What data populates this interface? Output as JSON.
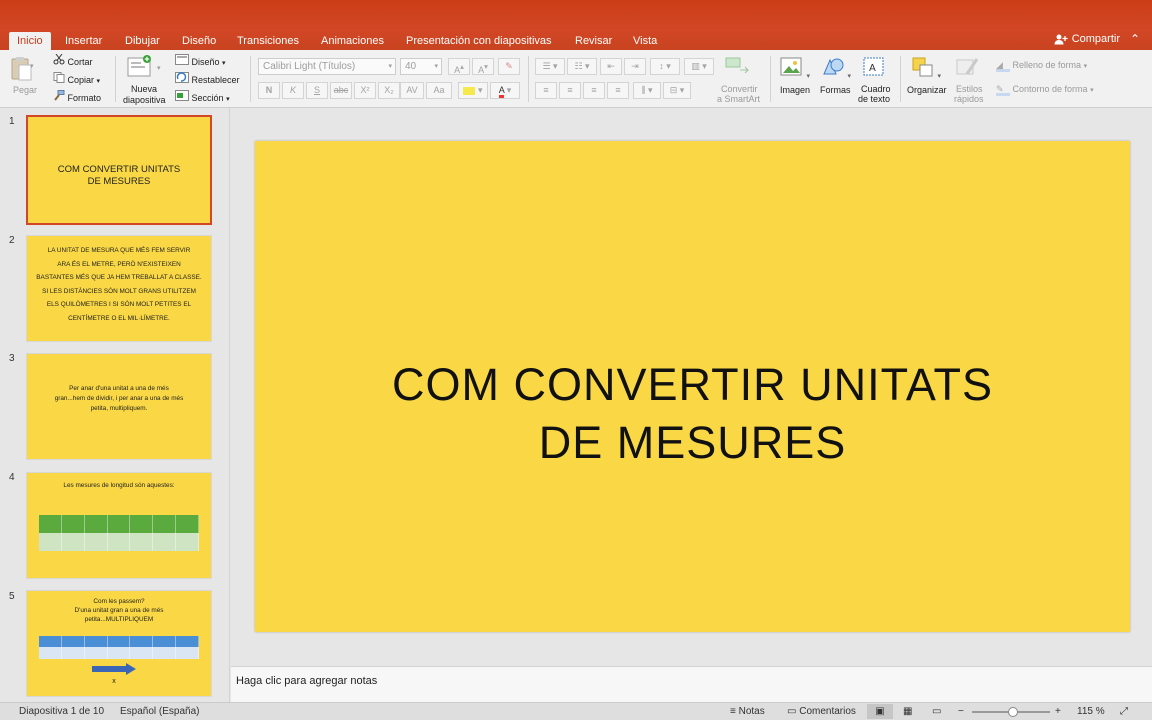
{
  "tabs": [
    "Inicio",
    "Insertar",
    "Dibujar",
    "Diseño",
    "Transiciones",
    "Animaciones",
    "Presentación con diapositivas",
    "Revisar",
    "Vista"
  ],
  "share_label": "Compartir",
  "ribbon": {
    "paste": "Pegar",
    "cut": "Cortar",
    "copy": "Copiar",
    "format": "Formato",
    "new_slide_1": "Nueva",
    "new_slide_2": "diapositiva",
    "layout": "Diseño",
    "reset": "Restablecer",
    "section": "Sección",
    "font_name": "Calibri Light (Títulos)",
    "font_size": "40",
    "convert_1": "Convertir",
    "convert_2": "a SmartArt",
    "image": "Imagen",
    "shapes": "Formas",
    "textbox_1": "Cuadro",
    "textbox_2": "de texto",
    "arrange": "Organizar",
    "quick_styles_1": "Estilos",
    "quick_styles_2": "rápidos",
    "shape_fill": "Relleno de forma",
    "shape_outline": "Contorno de forma"
  },
  "thumbnails": [
    {
      "num": "1",
      "lines": [
        "COM  CONVERTIR  UNITATS",
        "DE  MESURES"
      ]
    },
    {
      "num": "2",
      "lines": [
        "LA  UNITAT  DE  MESURA  QUE  MÉS  FEM  SERVIR",
        "ARA  ÉS  EL  METRE, PERÒ N'EXISTEIXEN",
        "BASTANTES MÉS QUE JA HEM TREBALLAT A CLASSE.",
        "SI LES DISTÀNCIES SÓN MOLT GRANS UTILITZEM",
        "ELS QUILÒMETRES I SI SÓN MOLT PETITES EL",
        "CENTÍMETRE O EL MIL·LÍMETRE."
      ]
    },
    {
      "num": "3",
      "lines": [
        "Per anar d'una unitat a una de més",
        "gran...hem de dividir, i per anar a una de més",
        "petita, multipliquem."
      ]
    },
    {
      "num": "4",
      "lines": [
        "Les mesures de longitud són aquestes:"
      ]
    },
    {
      "num": "5",
      "lines": [
        "Com les passem?",
        "D'una unitat gran a una de més",
        "petita...MULTIPLIQUEM"
      ],
      "extra": "x"
    }
  ],
  "slide": {
    "title": "COM  CONVERTIR  UNITATS\nDE  MESURES",
    "background": "#fad845"
  },
  "notes_placeholder": "Haga clic para agregar notas",
  "status": {
    "slide_info": "Diapositiva 1 de 10",
    "language": "Español (España)",
    "notes": "Notas",
    "comments": "Comentarios",
    "zoom": "115 %"
  },
  "colors": {
    "accent": "#d24726",
    "slide": "#fad845"
  }
}
